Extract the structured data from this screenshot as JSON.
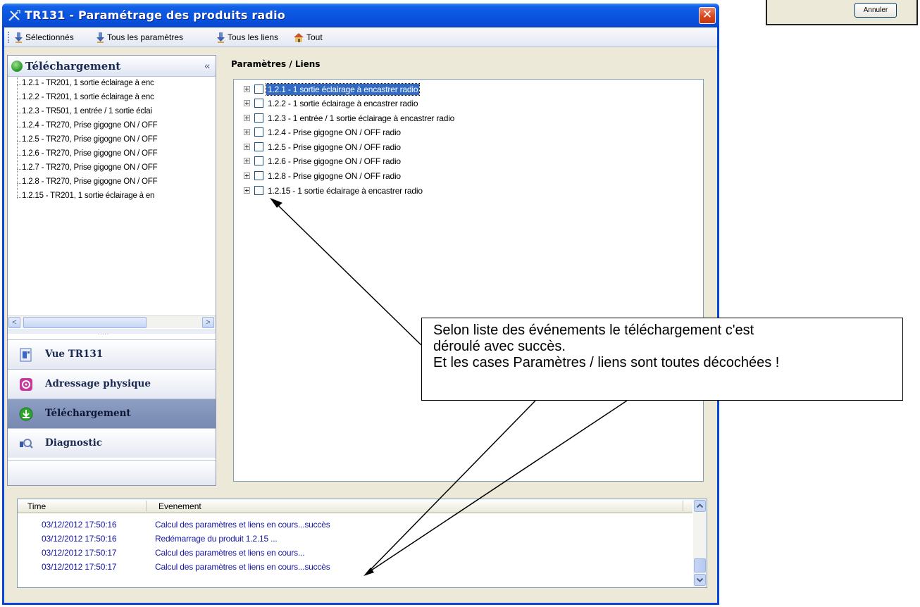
{
  "window": {
    "title": "TR131 - Paramétrage des produits radio",
    "close_symbol": "✕"
  },
  "toolbar": {
    "items": [
      {
        "label": "Sélectionnés",
        "icon": "download-selected-icon"
      },
      {
        "label": "Tous les paramètres",
        "icon": "download-params-icon"
      },
      {
        "label": "Tous les liens",
        "icon": "download-links-icon"
      },
      {
        "label": "Tout",
        "icon": "house-icon"
      }
    ]
  },
  "left_panel": {
    "header": "Téléchargement",
    "collapse_symbol": "«",
    "tree": [
      "1.2.1 - TR201, 1 sortie éclairage à enc",
      "1.2.2 - TR201, 1 sortie éclairage à enc",
      "1.2.3 - TR501, 1 entrée / 1 sortie éclai",
      "1.2.4 - TR270, Prise gigogne ON / OFF",
      "1.2.5 - TR270, Prise gigogne ON / OFF",
      "1.2.6 - TR270, Prise gigogne ON / OFF",
      "1.2.7 - TR270, Prise gigogne ON / OFF",
      "1.2.8 - TR270, Prise gigogne ON / OFF",
      "1.2.15 - TR201, 1 sortie éclairage à en"
    ],
    "scroll_left": "<",
    "scroll_right": ">",
    "splitter": "....."
  },
  "nav": {
    "items": [
      {
        "label": "Vue TR131",
        "icon": "device-view-icon",
        "active": false
      },
      {
        "label": "Adressage physique",
        "icon": "addressing-icon",
        "active": false
      },
      {
        "label": "Téléchargement",
        "icon": "download-icon",
        "active": true
      },
      {
        "label": "Diagnostic",
        "icon": "diagnostic-icon",
        "active": false
      }
    ]
  },
  "params": {
    "title": "Paramètres / Liens",
    "rows": [
      {
        "label": "1.2.1 - 1 sortie éclairage à encastrer radio",
        "checked": false,
        "selected": true
      },
      {
        "label": "1.2.2 - 1 sortie éclairage à encastrer radio",
        "checked": false,
        "selected": false
      },
      {
        "label": "1.2.3 - 1 entrée / 1 sortie éclairage à encastrer radio",
        "checked": false,
        "selected": false
      },
      {
        "label": "1.2.4 - Prise gigogne ON / OFF radio",
        "checked": false,
        "selected": false
      },
      {
        "label": "1.2.5 - Prise gigogne ON / OFF radio",
        "checked": false,
        "selected": false
      },
      {
        "label": "1.2.6 - Prise gigogne ON / OFF radio",
        "checked": false,
        "selected": false
      },
      {
        "label": "1.2.8 - Prise gigogne ON / OFF radio",
        "checked": false,
        "selected": false
      },
      {
        "label": "1.2.15 - 1 sortie éclairage à encastrer radio",
        "checked": false,
        "selected": false
      }
    ]
  },
  "log": {
    "col_time": "Time",
    "col_event": "Evenement",
    "rows": [
      {
        "time": "03/12/2012 17:50:16",
        "event": "Calcul des paramètres et liens en cours...succès"
      },
      {
        "time": "03/12/2012 17:50:16",
        "event": "Redémarrage du produit 1.2.15 ..."
      },
      {
        "time": "03/12/2012 17:50:17",
        "event": "Calcul des paramètres et liens en cours..."
      },
      {
        "time": "03/12/2012 17:50:17",
        "event": "Calcul des paramètres et liens en cours...succès"
      }
    ]
  },
  "annotation": {
    "line1": "Selon liste des événements le téléchargement c'est",
    "line2": "déroulé avec succès.",
    "line3": "Et les cases Paramètres / liens sont toutes décochées !"
  },
  "background_dialog": {
    "cancel_label": "Annuler"
  },
  "colors": {
    "titlebar": "#0a55e0",
    "selection": "#316ac5",
    "log_text": "#1515a8",
    "nav_active": "#7f90b9"
  }
}
